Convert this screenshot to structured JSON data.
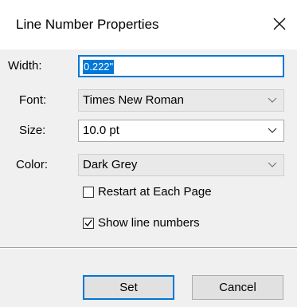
{
  "window": {
    "title": "Line Number Properties"
  },
  "form": {
    "width_label": "Width:",
    "width_value": "0.222\"",
    "font_label": "Font:",
    "font_value": "Times New Roman",
    "size_label": "Size:",
    "size_value": "10.0 pt",
    "color_label": "Color:",
    "color_value": "Dark Grey",
    "restart_label": "Restart at Each Page",
    "restart_checked": false,
    "show_label": "Show line numbers",
    "show_checked": true
  },
  "buttons": {
    "set_label": "Set",
    "cancel_label": "Cancel"
  },
  "colors": {
    "accent": "#0078d7",
    "dialog_bg": "#f0f0f0",
    "disabled_field": "#e9e9e9"
  }
}
